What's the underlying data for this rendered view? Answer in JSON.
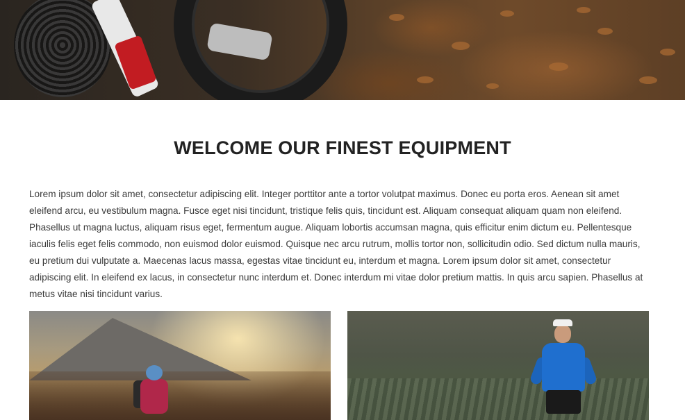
{
  "hero": {
    "image_description": "mountain-bike-on-autumn-leaves"
  },
  "section": {
    "title": "WELCOME OUR FINEST EQUIPMENT",
    "intro": "Lorem ipsum dolor sit amet, consectetur adipiscing elit. Integer porttitor ante a tortor volutpat maximus. Donec eu porta eros. Aenean sit amet eleifend arcu, eu vestibulum magna. Fusce eget nisi tincidunt, tristique felis quis, tincidunt est. Aliquam consequat aliquam quam non eleifend. Phasellus ut magna luctus, aliquam risus eget, fermentum augue. Aliquam lobortis accumsan magna, quis efficitur enim dictum eu. Pellentesque iaculis felis eget felis commodo, non euismod dolor euismod. Quisque nec arcu rutrum, mollis tortor non, sollicitudin odio. Sed dictum nulla mauris, eu pretium dui vulputate a. Maecenas lacus massa, egestas vitae tincidunt eu, interdum et magna. Lorem ipsum dolor sit amet, consectetur adipiscing elit. In eleifend ex lacus, in consectetur nunc interdum et. Donec interdum mi vitae dolor pretium mattis. In quis arcu sapien. Phasellus at metus vitae nisi tincidunt varius."
  },
  "photos": [
    {
      "subject": "hiker-in-sunlit-mountains"
    },
    {
      "subject": "trail-runner-in-blue-jacket"
    }
  ],
  "colors": {
    "heading": "#222222",
    "body_text": "#3a3a3a",
    "background": "#ffffff"
  }
}
